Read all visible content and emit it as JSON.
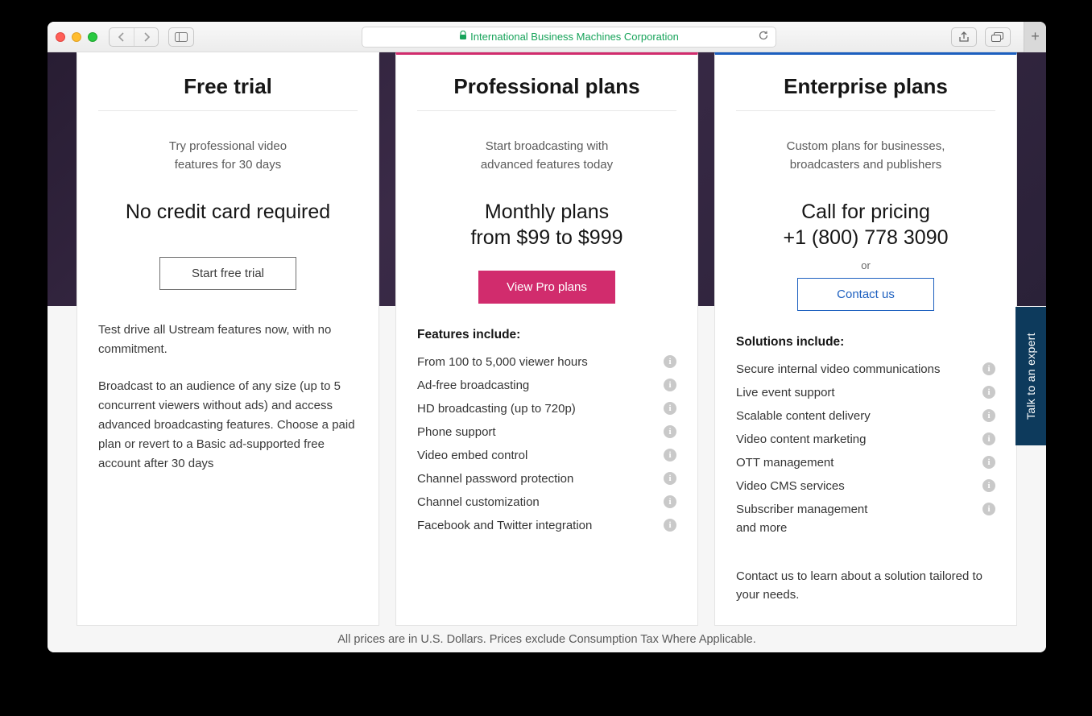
{
  "browser": {
    "address_label": "International Business Machines Corporation"
  },
  "side_tab": {
    "label": "Talk to an expert"
  },
  "footer": {
    "disclaimer": "All prices are in U.S. Dollars. Prices exclude Consumption Tax Where Applicable."
  },
  "plans": {
    "free": {
      "title": "Free trial",
      "lead_line1": "Try professional video",
      "lead_line2": "features for 30 days",
      "big_line": "No credit card required",
      "cta": "Start free trial",
      "para1": "Test drive all Ustream features now, with no commitment.",
      "para2": "Broadcast to an audience of any size (up to 5 concurrent viewers without ads) and access advanced broadcasting features. Choose a paid plan or revert to a Basic ad-supported free account after 30 days"
    },
    "pro": {
      "title": "Professional plans",
      "lead_line1": "Start broadcasting with",
      "lead_line2": "advanced features today",
      "big_line1": "Monthly plans",
      "big_line2": "from $99 to $999",
      "cta": "View Pro plans",
      "features_title": "Features include:",
      "features": [
        "From 100 to 5,000 viewer hours",
        "Ad-free broadcasting",
        "HD broadcasting (up to 720p)",
        "Phone support",
        "Video embed control",
        "Channel password protection",
        "Channel customization",
        "Facebook and Twitter integration"
      ]
    },
    "ent": {
      "title": "Enterprise plans",
      "lead_line1": "Custom plans for businesses,",
      "lead_line2": "broadcasters and publishers",
      "big_line1": "Call for pricing",
      "big_line2": "+1 (800) 778 3090",
      "or_label": "or",
      "cta": "Contact us",
      "features_title": "Solutions include:",
      "features": [
        "Secure internal video communications",
        "Live event support",
        "Scalable content delivery",
        "Video content marketing",
        "OTT management",
        "Video CMS services",
        "Subscriber management"
      ],
      "and_more": "and more",
      "tailored": "Contact us to learn about a solution tailored to your needs."
    }
  }
}
